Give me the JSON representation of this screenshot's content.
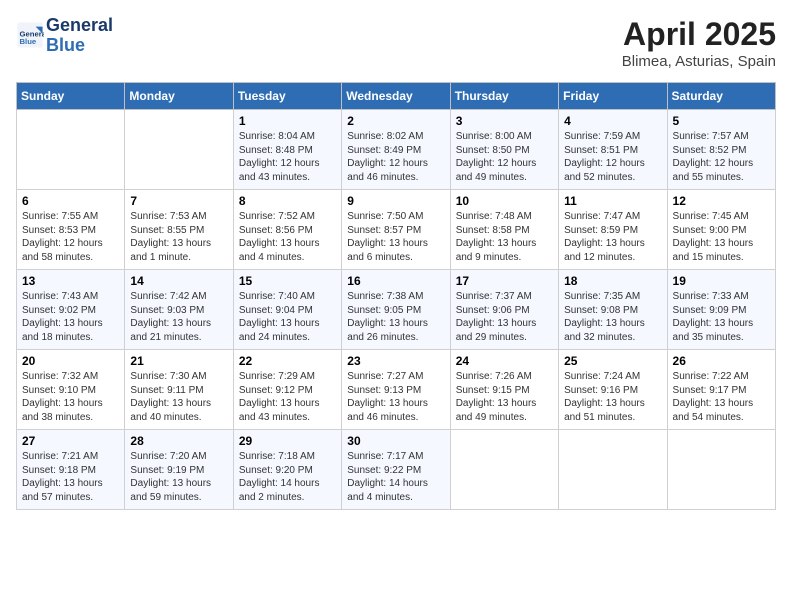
{
  "header": {
    "logo_line1": "General",
    "logo_line2": "Blue",
    "month_title": "April 2025",
    "location": "Blimea, Asturias, Spain"
  },
  "weekdays": [
    "Sunday",
    "Monday",
    "Tuesday",
    "Wednesday",
    "Thursday",
    "Friday",
    "Saturday"
  ],
  "weeks": [
    [
      {
        "day": "",
        "sunrise": "",
        "sunset": "",
        "daylight": ""
      },
      {
        "day": "",
        "sunrise": "",
        "sunset": "",
        "daylight": ""
      },
      {
        "day": "1",
        "sunrise": "Sunrise: 8:04 AM",
        "sunset": "Sunset: 8:48 PM",
        "daylight": "Daylight: 12 hours and 43 minutes."
      },
      {
        "day": "2",
        "sunrise": "Sunrise: 8:02 AM",
        "sunset": "Sunset: 8:49 PM",
        "daylight": "Daylight: 12 hours and 46 minutes."
      },
      {
        "day": "3",
        "sunrise": "Sunrise: 8:00 AM",
        "sunset": "Sunset: 8:50 PM",
        "daylight": "Daylight: 12 hours and 49 minutes."
      },
      {
        "day": "4",
        "sunrise": "Sunrise: 7:59 AM",
        "sunset": "Sunset: 8:51 PM",
        "daylight": "Daylight: 12 hours and 52 minutes."
      },
      {
        "day": "5",
        "sunrise": "Sunrise: 7:57 AM",
        "sunset": "Sunset: 8:52 PM",
        "daylight": "Daylight: 12 hours and 55 minutes."
      }
    ],
    [
      {
        "day": "6",
        "sunrise": "Sunrise: 7:55 AM",
        "sunset": "Sunset: 8:53 PM",
        "daylight": "Daylight: 12 hours and 58 minutes."
      },
      {
        "day": "7",
        "sunrise": "Sunrise: 7:53 AM",
        "sunset": "Sunset: 8:55 PM",
        "daylight": "Daylight: 13 hours and 1 minute."
      },
      {
        "day": "8",
        "sunrise": "Sunrise: 7:52 AM",
        "sunset": "Sunset: 8:56 PM",
        "daylight": "Daylight: 13 hours and 4 minutes."
      },
      {
        "day": "9",
        "sunrise": "Sunrise: 7:50 AM",
        "sunset": "Sunset: 8:57 PM",
        "daylight": "Daylight: 13 hours and 6 minutes."
      },
      {
        "day": "10",
        "sunrise": "Sunrise: 7:48 AM",
        "sunset": "Sunset: 8:58 PM",
        "daylight": "Daylight: 13 hours and 9 minutes."
      },
      {
        "day": "11",
        "sunrise": "Sunrise: 7:47 AM",
        "sunset": "Sunset: 8:59 PM",
        "daylight": "Daylight: 13 hours and 12 minutes."
      },
      {
        "day": "12",
        "sunrise": "Sunrise: 7:45 AM",
        "sunset": "Sunset: 9:00 PM",
        "daylight": "Daylight: 13 hours and 15 minutes."
      }
    ],
    [
      {
        "day": "13",
        "sunrise": "Sunrise: 7:43 AM",
        "sunset": "Sunset: 9:02 PM",
        "daylight": "Daylight: 13 hours and 18 minutes."
      },
      {
        "day": "14",
        "sunrise": "Sunrise: 7:42 AM",
        "sunset": "Sunset: 9:03 PM",
        "daylight": "Daylight: 13 hours and 21 minutes."
      },
      {
        "day": "15",
        "sunrise": "Sunrise: 7:40 AM",
        "sunset": "Sunset: 9:04 PM",
        "daylight": "Daylight: 13 hours and 24 minutes."
      },
      {
        "day": "16",
        "sunrise": "Sunrise: 7:38 AM",
        "sunset": "Sunset: 9:05 PM",
        "daylight": "Daylight: 13 hours and 26 minutes."
      },
      {
        "day": "17",
        "sunrise": "Sunrise: 7:37 AM",
        "sunset": "Sunset: 9:06 PM",
        "daylight": "Daylight: 13 hours and 29 minutes."
      },
      {
        "day": "18",
        "sunrise": "Sunrise: 7:35 AM",
        "sunset": "Sunset: 9:08 PM",
        "daylight": "Daylight: 13 hours and 32 minutes."
      },
      {
        "day": "19",
        "sunrise": "Sunrise: 7:33 AM",
        "sunset": "Sunset: 9:09 PM",
        "daylight": "Daylight: 13 hours and 35 minutes."
      }
    ],
    [
      {
        "day": "20",
        "sunrise": "Sunrise: 7:32 AM",
        "sunset": "Sunset: 9:10 PM",
        "daylight": "Daylight: 13 hours and 38 minutes."
      },
      {
        "day": "21",
        "sunrise": "Sunrise: 7:30 AM",
        "sunset": "Sunset: 9:11 PM",
        "daylight": "Daylight: 13 hours and 40 minutes."
      },
      {
        "day": "22",
        "sunrise": "Sunrise: 7:29 AM",
        "sunset": "Sunset: 9:12 PM",
        "daylight": "Daylight: 13 hours and 43 minutes."
      },
      {
        "day": "23",
        "sunrise": "Sunrise: 7:27 AM",
        "sunset": "Sunset: 9:13 PM",
        "daylight": "Daylight: 13 hours and 46 minutes."
      },
      {
        "day": "24",
        "sunrise": "Sunrise: 7:26 AM",
        "sunset": "Sunset: 9:15 PM",
        "daylight": "Daylight: 13 hours and 49 minutes."
      },
      {
        "day": "25",
        "sunrise": "Sunrise: 7:24 AM",
        "sunset": "Sunset: 9:16 PM",
        "daylight": "Daylight: 13 hours and 51 minutes."
      },
      {
        "day": "26",
        "sunrise": "Sunrise: 7:22 AM",
        "sunset": "Sunset: 9:17 PM",
        "daylight": "Daylight: 13 hours and 54 minutes."
      }
    ],
    [
      {
        "day": "27",
        "sunrise": "Sunrise: 7:21 AM",
        "sunset": "Sunset: 9:18 PM",
        "daylight": "Daylight: 13 hours and 57 minutes."
      },
      {
        "day": "28",
        "sunrise": "Sunrise: 7:20 AM",
        "sunset": "Sunset: 9:19 PM",
        "daylight": "Daylight: 13 hours and 59 minutes."
      },
      {
        "day": "29",
        "sunrise": "Sunrise: 7:18 AM",
        "sunset": "Sunset: 9:20 PM",
        "daylight": "Daylight: 14 hours and 2 minutes."
      },
      {
        "day": "30",
        "sunrise": "Sunrise: 7:17 AM",
        "sunset": "Sunset: 9:22 PM",
        "daylight": "Daylight: 14 hours and 4 minutes."
      },
      {
        "day": "",
        "sunrise": "",
        "sunset": "",
        "daylight": ""
      },
      {
        "day": "",
        "sunrise": "",
        "sunset": "",
        "daylight": ""
      },
      {
        "day": "",
        "sunrise": "",
        "sunset": "",
        "daylight": ""
      }
    ]
  ]
}
